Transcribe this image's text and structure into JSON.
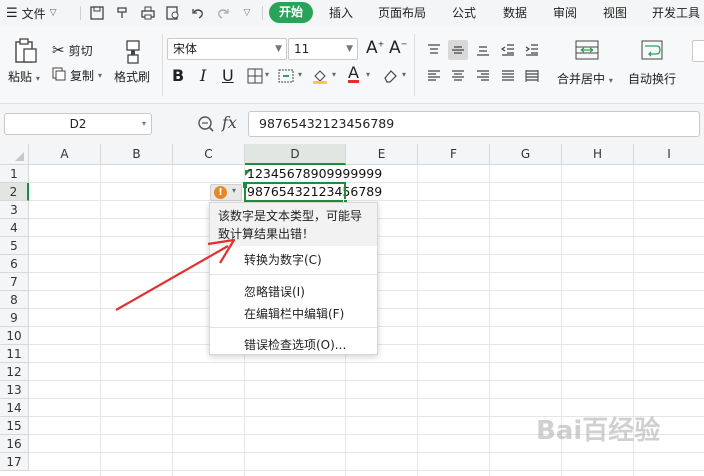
{
  "menubar": {
    "file_label": "文件",
    "tabs": [
      "开始",
      "插入",
      "页面布局",
      "公式",
      "数据",
      "审阅",
      "视图",
      "开发工具"
    ]
  },
  "ribbon": {
    "paste_label": "粘贴",
    "cut_label": "剪切",
    "copy_label": "复制",
    "format_painter_label": "格式刷",
    "font_name": "宋体",
    "font_size": "11",
    "bold_label": "B",
    "italic_label": "I",
    "underline_label": "U",
    "font_color_label": "A",
    "font_increase_label": "A",
    "font_decrease_label": "A",
    "merge_label": "合并居中",
    "wrap_label": "自动换行"
  },
  "formula_bar": {
    "name_box": "D2",
    "fx_label": "fx",
    "value": "98765432123456789"
  },
  "grid": {
    "columns": [
      "A",
      "B",
      "C",
      "D",
      "E",
      "F",
      "G",
      "H",
      "I"
    ],
    "rows": [
      "1",
      "2",
      "3",
      "4",
      "5",
      "6",
      "7",
      "8",
      "9",
      "10",
      "11",
      "12",
      "13",
      "14",
      "15",
      "16",
      "17"
    ],
    "cells": {
      "D1": "12345678909999999",
      "D2": "98765432123456789"
    }
  },
  "popup": {
    "message": "该数字是文本类型，可能导致计算结果出错！",
    "items": {
      "convert": "转换为数字(C)",
      "ignore": "忽略错误(I)",
      "edit": "在编辑栏中编辑(F)",
      "options": "错误检查选项(O)..."
    }
  },
  "colors": {
    "accent_green": "#2aa35a",
    "warning_orange": "#e4882a",
    "annotation_red": "#e03030",
    "selection_green": "#1e8e3e"
  },
  "watermark": "Bai百经验"
}
